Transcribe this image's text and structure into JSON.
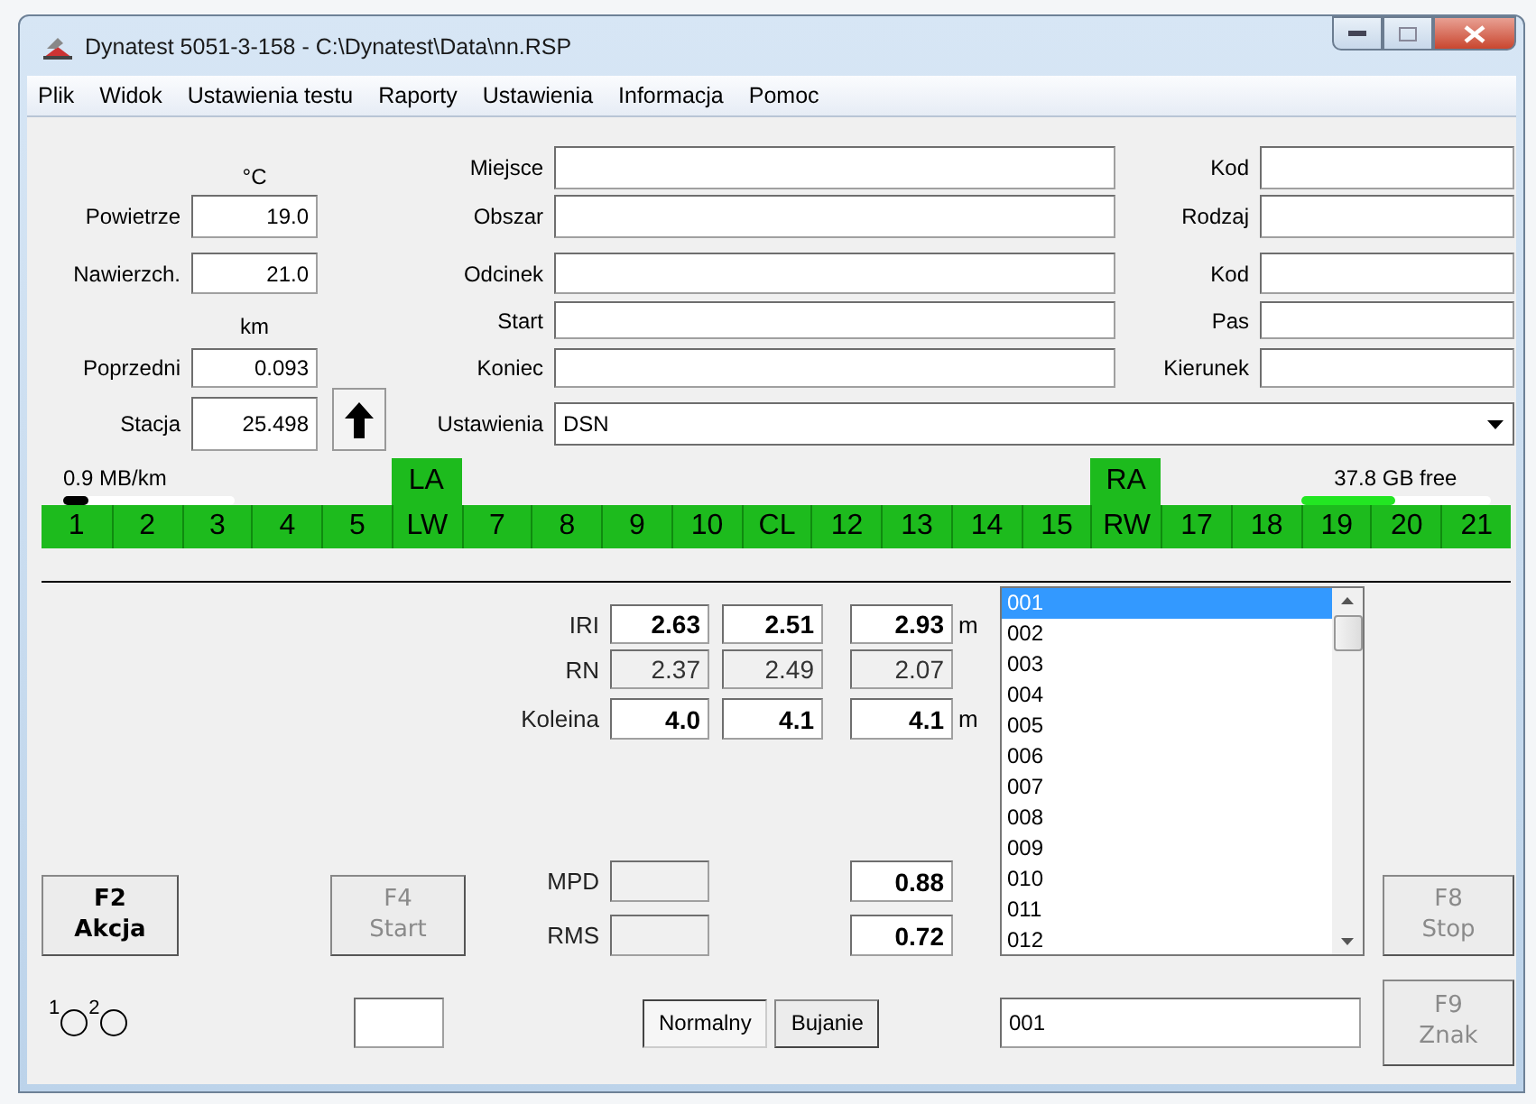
{
  "window": {
    "title": "Dynatest 5051-3-158 - C:\\Dynatest\\Data\\nn.RSP"
  },
  "menu": [
    "Plik",
    "Widok",
    "Ustawienia testu",
    "Raporty",
    "Ustawienia",
    "Informacja",
    "Pomoc"
  ],
  "left_column": [
    {
      "kind": "unit",
      "text": "°C"
    },
    {
      "kind": "field",
      "label": "Powietrze",
      "value": "19.0"
    },
    {
      "kind": "field",
      "label": "Nawierzch.",
      "value": "21.0"
    },
    {
      "kind": "unit",
      "text": "km"
    },
    {
      "kind": "field",
      "label": "Poprzedni",
      "value": "0.093"
    },
    {
      "kind": "field",
      "label": "Stacja",
      "value": "25.498"
    }
  ],
  "location_fields": [
    {
      "label": "Miejsce"
    },
    {
      "label": "Obszar"
    },
    {
      "label": "Odcinek"
    },
    {
      "label": "Start"
    },
    {
      "label": "Koniec"
    }
  ],
  "code_fields": [
    {
      "label": "Kod"
    },
    {
      "label": "Rodzaj"
    },
    {
      "label": "Kod"
    },
    {
      "label": "Pas"
    },
    {
      "label": "Kierunek"
    }
  ],
  "settings": {
    "label": "Ustawienia",
    "value": "DSN"
  },
  "data_rate": {
    "text": "0.9 MB/km",
    "level": 0.15
  },
  "disk": {
    "text": "37.8 GB free",
    "level": 0.5
  },
  "lanes": [
    {
      "label": "1"
    },
    {
      "label": "2"
    },
    {
      "label": "3"
    },
    {
      "label": "4"
    },
    {
      "label": "5"
    },
    {
      "label": "LW",
      "marker": "LA"
    },
    {
      "label": "7"
    },
    {
      "label": "8"
    },
    {
      "label": "9"
    },
    {
      "label": "10"
    },
    {
      "label": "CL"
    },
    {
      "label": "12"
    },
    {
      "label": "13"
    },
    {
      "label": "14"
    },
    {
      "label": "15"
    },
    {
      "label": "RW",
      "marker": "RA"
    },
    {
      "label": "17"
    },
    {
      "label": "18"
    },
    {
      "label": "19"
    },
    {
      "label": "20"
    },
    {
      "label": "21"
    }
  ],
  "measurements": [
    {
      "label": "IRI",
      "readonly": false,
      "values": [
        "2.63",
        "2.51",
        "2.93"
      ],
      "unit": "m"
    },
    {
      "label": "RN",
      "readonly": true,
      "values": [
        "2.37",
        "2.49",
        "2.07"
      ]
    },
    {
      "label": "Koleina",
      "readonly": false,
      "values": [
        "4.0",
        "4.1",
        "4.1"
      ],
      "unit": "m"
    }
  ],
  "texture": [
    {
      "label": "MPD",
      "value": "0.88"
    },
    {
      "label": "RMS",
      "value": "0.72"
    }
  ],
  "list": [
    {
      "text": "001",
      "selected": true
    },
    {
      "text": "002",
      "selected": false
    },
    {
      "text": "003",
      "selected": false
    },
    {
      "text": "004",
      "selected": false
    },
    {
      "text": "005",
      "selected": false
    },
    {
      "text": "006",
      "selected": false
    },
    {
      "text": "007",
      "selected": false
    },
    {
      "text": "008",
      "selected": false
    },
    {
      "text": "009",
      "selected": false
    },
    {
      "text": "010",
      "selected": false
    },
    {
      "text": "011",
      "selected": false
    },
    {
      "text": "012",
      "selected": false
    }
  ],
  "list_input": {
    "value": "001"
  },
  "buttons": [
    {
      "key": "F2",
      "label": "Akcja",
      "disabled": false
    },
    {
      "key": "F4",
      "label": "Start",
      "disabled": true
    },
    {
      "key": "F8",
      "label": "Stop",
      "disabled": true
    },
    {
      "key": "F9",
      "label": "Znak",
      "disabled": true
    }
  ],
  "modes": [
    {
      "label": "Normalny",
      "selected": true
    },
    {
      "label": "Bujanie",
      "selected": false
    }
  ],
  "indicators": [
    {
      "label": "1",
      "on": false
    },
    {
      "label": "2",
      "on": false
    }
  ]
}
